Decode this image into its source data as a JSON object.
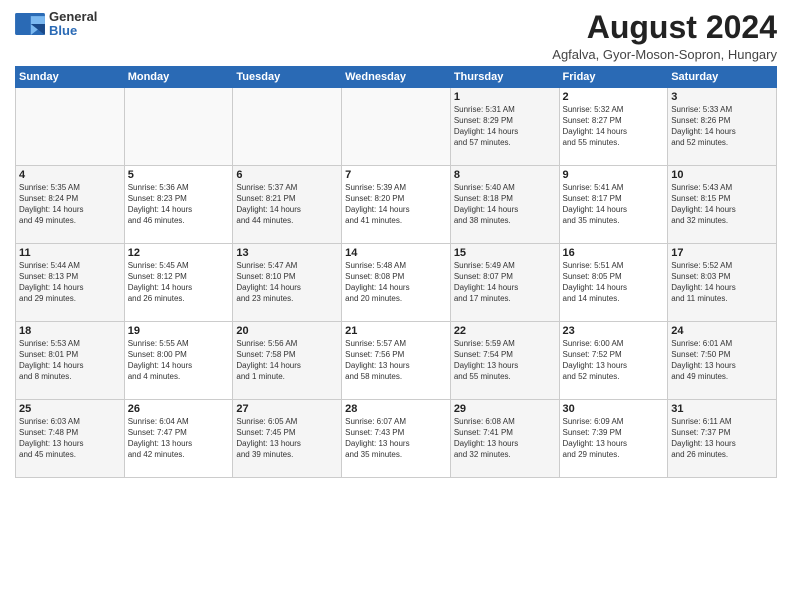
{
  "header": {
    "logo_general": "General",
    "logo_blue": "Blue",
    "month_year": "August 2024",
    "location": "Agfalva, Gyor-Moson-Sopron, Hungary"
  },
  "days_of_week": [
    "Sunday",
    "Monday",
    "Tuesday",
    "Wednesday",
    "Thursday",
    "Friday",
    "Saturday"
  ],
  "weeks": [
    [
      {
        "date": "",
        "text": ""
      },
      {
        "date": "",
        "text": ""
      },
      {
        "date": "",
        "text": ""
      },
      {
        "date": "",
        "text": ""
      },
      {
        "date": "1",
        "text": "Sunrise: 5:31 AM\nSunset: 8:29 PM\nDaylight: 14 hours\nand 57 minutes."
      },
      {
        "date": "2",
        "text": "Sunrise: 5:32 AM\nSunset: 8:27 PM\nDaylight: 14 hours\nand 55 minutes."
      },
      {
        "date": "3",
        "text": "Sunrise: 5:33 AM\nSunset: 8:26 PM\nDaylight: 14 hours\nand 52 minutes."
      }
    ],
    [
      {
        "date": "4",
        "text": "Sunrise: 5:35 AM\nSunset: 8:24 PM\nDaylight: 14 hours\nand 49 minutes."
      },
      {
        "date": "5",
        "text": "Sunrise: 5:36 AM\nSunset: 8:23 PM\nDaylight: 14 hours\nand 46 minutes."
      },
      {
        "date": "6",
        "text": "Sunrise: 5:37 AM\nSunset: 8:21 PM\nDaylight: 14 hours\nand 44 minutes."
      },
      {
        "date": "7",
        "text": "Sunrise: 5:39 AM\nSunset: 8:20 PM\nDaylight: 14 hours\nand 41 minutes."
      },
      {
        "date": "8",
        "text": "Sunrise: 5:40 AM\nSunset: 8:18 PM\nDaylight: 14 hours\nand 38 minutes."
      },
      {
        "date": "9",
        "text": "Sunrise: 5:41 AM\nSunset: 8:17 PM\nDaylight: 14 hours\nand 35 minutes."
      },
      {
        "date": "10",
        "text": "Sunrise: 5:43 AM\nSunset: 8:15 PM\nDaylight: 14 hours\nand 32 minutes."
      }
    ],
    [
      {
        "date": "11",
        "text": "Sunrise: 5:44 AM\nSunset: 8:13 PM\nDaylight: 14 hours\nand 29 minutes."
      },
      {
        "date": "12",
        "text": "Sunrise: 5:45 AM\nSunset: 8:12 PM\nDaylight: 14 hours\nand 26 minutes."
      },
      {
        "date": "13",
        "text": "Sunrise: 5:47 AM\nSunset: 8:10 PM\nDaylight: 14 hours\nand 23 minutes."
      },
      {
        "date": "14",
        "text": "Sunrise: 5:48 AM\nSunset: 8:08 PM\nDaylight: 14 hours\nand 20 minutes."
      },
      {
        "date": "15",
        "text": "Sunrise: 5:49 AM\nSunset: 8:07 PM\nDaylight: 14 hours\nand 17 minutes."
      },
      {
        "date": "16",
        "text": "Sunrise: 5:51 AM\nSunset: 8:05 PM\nDaylight: 14 hours\nand 14 minutes."
      },
      {
        "date": "17",
        "text": "Sunrise: 5:52 AM\nSunset: 8:03 PM\nDaylight: 14 hours\nand 11 minutes."
      }
    ],
    [
      {
        "date": "18",
        "text": "Sunrise: 5:53 AM\nSunset: 8:01 PM\nDaylight: 14 hours\nand 8 minutes."
      },
      {
        "date": "19",
        "text": "Sunrise: 5:55 AM\nSunset: 8:00 PM\nDaylight: 14 hours\nand 4 minutes."
      },
      {
        "date": "20",
        "text": "Sunrise: 5:56 AM\nSunset: 7:58 PM\nDaylight: 14 hours\nand 1 minute."
      },
      {
        "date": "21",
        "text": "Sunrise: 5:57 AM\nSunset: 7:56 PM\nDaylight: 13 hours\nand 58 minutes."
      },
      {
        "date": "22",
        "text": "Sunrise: 5:59 AM\nSunset: 7:54 PM\nDaylight: 13 hours\nand 55 minutes."
      },
      {
        "date": "23",
        "text": "Sunrise: 6:00 AM\nSunset: 7:52 PM\nDaylight: 13 hours\nand 52 minutes."
      },
      {
        "date": "24",
        "text": "Sunrise: 6:01 AM\nSunset: 7:50 PM\nDaylight: 13 hours\nand 49 minutes."
      }
    ],
    [
      {
        "date": "25",
        "text": "Sunrise: 6:03 AM\nSunset: 7:48 PM\nDaylight: 13 hours\nand 45 minutes."
      },
      {
        "date": "26",
        "text": "Sunrise: 6:04 AM\nSunset: 7:47 PM\nDaylight: 13 hours\nand 42 minutes."
      },
      {
        "date": "27",
        "text": "Sunrise: 6:05 AM\nSunset: 7:45 PM\nDaylight: 13 hours\nand 39 minutes."
      },
      {
        "date": "28",
        "text": "Sunrise: 6:07 AM\nSunset: 7:43 PM\nDaylight: 13 hours\nand 35 minutes."
      },
      {
        "date": "29",
        "text": "Sunrise: 6:08 AM\nSunset: 7:41 PM\nDaylight: 13 hours\nand 32 minutes."
      },
      {
        "date": "30",
        "text": "Sunrise: 6:09 AM\nSunset: 7:39 PM\nDaylight: 13 hours\nand 29 minutes."
      },
      {
        "date": "31",
        "text": "Sunrise: 6:11 AM\nSunset: 7:37 PM\nDaylight: 13 hours\nand 26 minutes."
      }
    ]
  ]
}
